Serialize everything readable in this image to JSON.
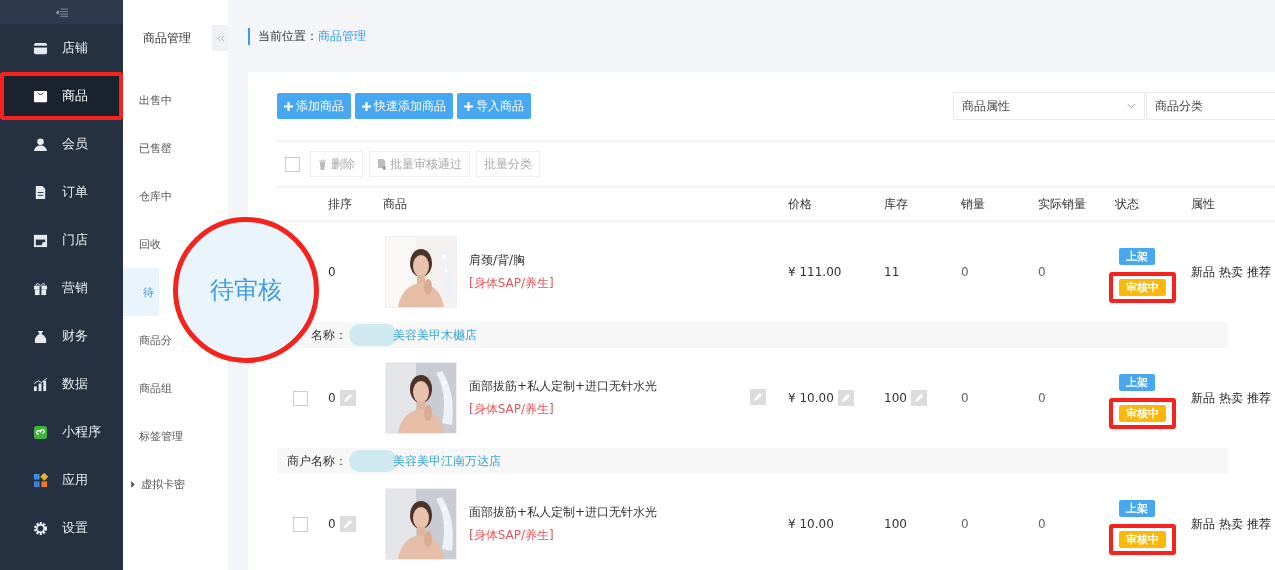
{
  "sidebar": {
    "items": [
      {
        "label": "店铺",
        "selected": false,
        "highlighted": false
      },
      {
        "label": "商品",
        "selected": true,
        "highlighted": true
      },
      {
        "label": "会员",
        "selected": false,
        "highlighted": false
      },
      {
        "label": "订单",
        "selected": false,
        "highlighted": false
      },
      {
        "label": "门店",
        "selected": false,
        "highlighted": false
      },
      {
        "label": "营销",
        "selected": false,
        "highlighted": false
      },
      {
        "label": "财务",
        "selected": false,
        "highlighted": false
      },
      {
        "label": "数据",
        "selected": false,
        "highlighted": false
      },
      {
        "label": "小程序",
        "selected": false,
        "highlighted": false
      },
      {
        "label": "应用",
        "selected": false,
        "highlighted": false
      },
      {
        "label": "设置",
        "selected": false,
        "highlighted": false
      }
    ]
  },
  "submenu": {
    "title": "商品管理",
    "items": [
      {
        "label": "出售中",
        "selected": false,
        "kind": "item"
      },
      {
        "label": "已售罄",
        "selected": false,
        "kind": "item"
      },
      {
        "label": "仓库中",
        "selected": false,
        "kind": "item"
      },
      {
        "label": "回收",
        "selected": false,
        "kind": "item"
      },
      {
        "label": "待",
        "selected": true,
        "kind": "item"
      },
      {
        "label": "商品分",
        "selected": false,
        "kind": "item"
      },
      {
        "label": "商品组",
        "selected": false,
        "kind": "item"
      },
      {
        "label": "标签管理",
        "selected": false,
        "kind": "item"
      },
      {
        "label": "虚拟卡密",
        "selected": false,
        "kind": "group"
      }
    ]
  },
  "breadcrumb": {
    "label": "当前位置：",
    "current": "商品管理"
  },
  "actions": [
    "添加商品",
    "快速添加商品",
    "导入商品"
  ],
  "filters": [
    {
      "placeholder": "商品属性",
      "kind": "select"
    },
    {
      "placeholder": "商品分类",
      "kind": "field"
    }
  ],
  "select_all": {
    "checked": false
  },
  "bulk_actions": [
    {
      "label": "删除",
      "kind": "trash"
    },
    {
      "label": "批量审核通过",
      "kind": "doc"
    },
    {
      "label": "批量分类",
      "kind": "plain"
    }
  ],
  "table": {
    "columns": [
      "排序",
      "商品",
      "价格",
      "库存",
      "销量",
      "实际销量",
      "状态",
      "属性"
    ],
    "rows": [
      {
        "kind": "product",
        "sort": "0",
        "name": "肩颈/背/胸",
        "tag": "[身体SAP/养生]",
        "price": "¥ 111.00",
        "stock": "11",
        "sales": "0",
        "actual_sales": "0",
        "sort_editable": false,
        "name_editable": false,
        "price_editable": false,
        "stock_editable": false,
        "statuses": [
          {
            "label": "上架",
            "kind": "listed",
            "highlighted": false
          },
          {
            "label": "审核中",
            "kind": "review",
            "highlighted": true
          }
        ],
        "attributes": "新品 热卖 推荐"
      },
      {
        "kind": "merchant",
        "label": "名称：",
        "name": "美容美甲木樾店"
      },
      {
        "kind": "product",
        "checked": false,
        "sort": "0",
        "name": "面部拔筋+私人定制+进口无针水光",
        "tag": "[身体SAP/养生]",
        "price": "¥ 10.00",
        "stock": "100",
        "sales": "0",
        "actual_sales": "0",
        "sort_editable": true,
        "name_editable": true,
        "price_editable": true,
        "stock_editable": true,
        "statuses": [
          {
            "label": "上架",
            "kind": "listed",
            "highlighted": false
          },
          {
            "label": "审核中",
            "kind": "review",
            "highlighted": true
          }
        ],
        "attributes": "新品 热卖 推荐"
      },
      {
        "kind": "merchant",
        "label": "商户名称：",
        "name": "美容美甲江南万达店"
      },
      {
        "kind": "product",
        "checked": false,
        "sort": "0",
        "name": "面部拔筋+私人定制+进口无针水光",
        "tag": "[身体SAP/养生]",
        "price": "¥ 10.00",
        "stock": "100",
        "sales": "0",
        "actual_sales": "0",
        "sort_editable": true,
        "name_editable": false,
        "price_editable": false,
        "stock_editable": false,
        "statuses": [
          {
            "label": "上架",
            "kind": "listed",
            "highlighted": false
          },
          {
            "label": "审核中",
            "kind": "review",
            "highlighted": true
          }
        ],
        "attributes": "新品 热卖 推荐"
      }
    ]
  },
  "magnifier": {
    "text": "待审核"
  }
}
